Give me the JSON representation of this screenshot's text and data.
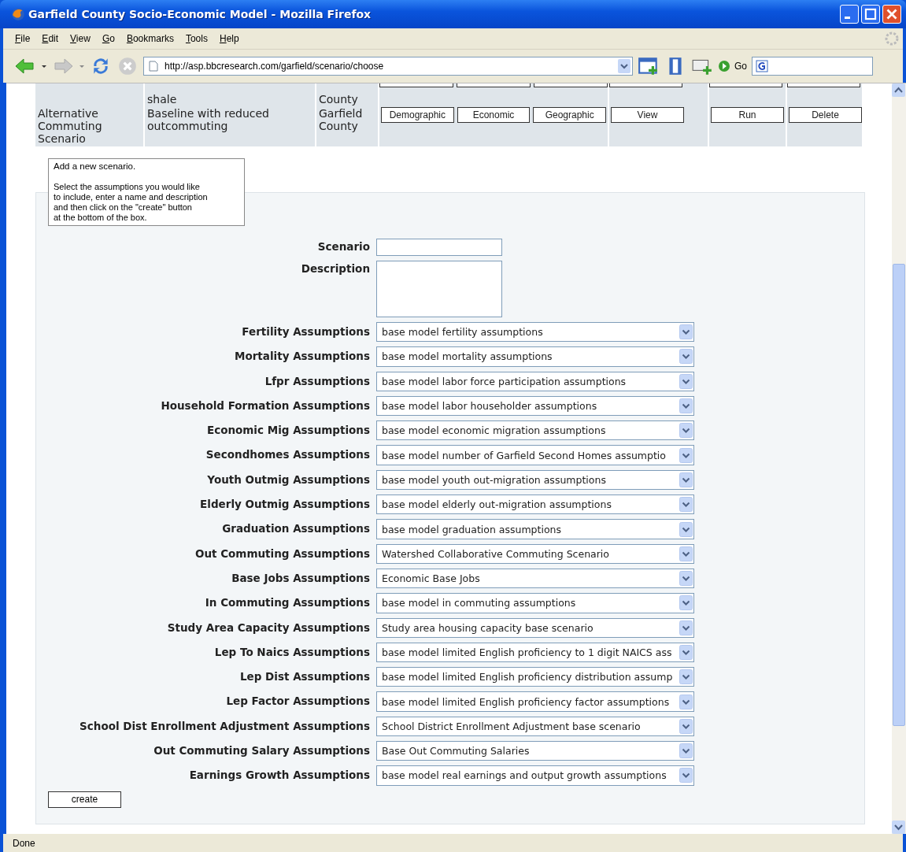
{
  "window": {
    "title": "Garfield County Socio-Economic Model - Mozilla Firefox"
  },
  "menu": [
    "File",
    "Edit",
    "View",
    "Go",
    "Bookmarks",
    "Tools",
    "Help"
  ],
  "toolbar": {
    "address": "http://asp.bbcresearch.com/garfield/scenario/choose",
    "go_label": "Go"
  },
  "scenarios": [
    {
      "kind": "cut",
      "description": "shale",
      "region": "County"
    },
    {
      "kind": "full",
      "name": "Alternative Commuting Scenario",
      "description": "Baseline with reduced outcommuting",
      "region": "Garfield County",
      "buttons": [
        "Demographic",
        "Economic",
        "Geographic",
        "View",
        "Run",
        "Delete"
      ]
    }
  ],
  "tooltip": {
    "title": "Add a new scenario.",
    "text": "Select the assumptions you would like\nto include, enter a name and description\nand then click on the \"create\" button\nat the bottom of the box."
  },
  "form": {
    "scenario_label": "Scenario",
    "description_label": "Description",
    "assumptions": [
      {
        "label": "Fertility Assumptions",
        "value": "base model fertility assumptions"
      },
      {
        "label": "Mortality Assumptions",
        "value": "base model mortality assumptions"
      },
      {
        "label": "Lfpr Assumptions",
        "value": "base model labor force participation assumptions"
      },
      {
        "label": "Household Formation Assumptions",
        "value": "base model labor householder assumptions"
      },
      {
        "label": "Economic Mig Assumptions",
        "value": "base model economic migration assumptions"
      },
      {
        "label": "Secondhomes Assumptions",
        "value": "base model number of Garfield Second Homes assumptio"
      },
      {
        "label": "Youth Outmig Assumptions",
        "value": "base model youth out-migration assumptions"
      },
      {
        "label": "Elderly Outmig Assumptions",
        "value": "base model elderly out-migration assumptions"
      },
      {
        "label": "Graduation Assumptions",
        "value": "base model graduation assumptions"
      },
      {
        "label": "Out Commuting Assumptions",
        "value": "Watershed Collaborative Commuting Scenario"
      },
      {
        "label": "Base Jobs Assumptions",
        "value": "Economic Base Jobs"
      },
      {
        "label": "In Commuting Assumptions",
        "value": "base model in commuting assumptions"
      },
      {
        "label": "Study Area Capacity Assumptions",
        "value": "Study area housing capacity base scenario"
      },
      {
        "label": "Lep To Naics Assumptions",
        "value": "base model limited English proficiency to 1 digit NAICS ass"
      },
      {
        "label": "Lep Dist Assumptions",
        "value": "base model limited English proficiency distribution assump"
      },
      {
        "label": "Lep Factor Assumptions",
        "value": "base model limited English proficiency factor assumptions"
      },
      {
        "label": "School Dist Enrollment Adjustment Assumptions",
        "value": "School District Enrollment Adjustment base scenario"
      },
      {
        "label": "Out Commuting Salary Assumptions",
        "value": "Base Out Commuting Salaries"
      },
      {
        "label": "Earnings Growth Assumptions",
        "value": "base model real earnings and output growth assumptions"
      }
    ],
    "create_label": "create"
  },
  "status_bar": {
    "text": "Done"
  }
}
